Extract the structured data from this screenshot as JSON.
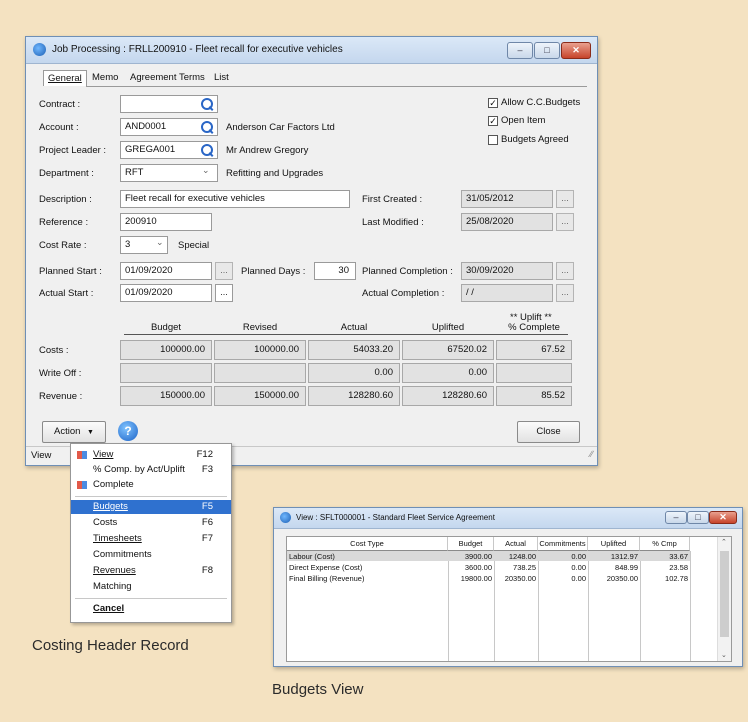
{
  "main": {
    "title": "Job Processing : FRLL200910 - Fleet recall for executive vehicles",
    "tabs": [
      {
        "label": "General"
      },
      {
        "label": "Memo"
      },
      {
        "label": "Agreement Terms"
      },
      {
        "label": "List"
      }
    ],
    "contract_label": "Contract :",
    "contract_value": "",
    "account_label": "Account :",
    "account_value": "AND0001",
    "account_name": "Anderson Car Factors Ltd",
    "project_leader_label": "Project Leader :",
    "project_leader_value": "GREGA001",
    "project_leader_name": "Mr Andrew Gregory",
    "department_label": "Department :",
    "department_value": "RFT",
    "department_name": "Refitting and Upgrades",
    "checks": [
      {
        "label": "Allow C.C.Budgets",
        "checked": true
      },
      {
        "label": "Open Item",
        "checked": true
      },
      {
        "label": "Budgets Agreed",
        "checked": false
      }
    ],
    "description_label": "Description :",
    "description_value": "Fleet recall for executive vehicles",
    "reference_label": "Reference :",
    "reference_value": "200910",
    "cost_rate_label": "Cost Rate :",
    "cost_rate_value": "3",
    "cost_rate_name": "Special",
    "first_created_label": "First Created :",
    "first_created_value": "31/05/2012",
    "last_modified_label": "Last Modified :",
    "last_modified_value": "25/08/2020",
    "planned_start_label": "Planned Start :",
    "planned_start_value": "01/09/2020",
    "planned_days_label": "Planned Days :",
    "planned_days_value": "30",
    "planned_completion_label": "Planned Completion :",
    "planned_completion_value": "30/09/2020",
    "actual_start_label": "Actual Start :",
    "actual_start_value": "01/09/2020",
    "actual_completion_label": "Actual Completion :",
    "actual_completion_value": "/ /",
    "uplift_note": "** Uplift **",
    "columns": [
      "Budget",
      "Revised",
      "Actual",
      "Uplifted",
      "% Complete"
    ],
    "rows": [
      {
        "label": "Costs :",
        "cells": [
          "100000.00",
          "100000.00",
          "54033.20",
          "67520.02",
          "67.52"
        ]
      },
      {
        "label": "Write Off :",
        "cells": [
          "",
          "",
          "0.00",
          "0.00",
          ""
        ]
      },
      {
        "label": "Revenue :",
        "cells": [
          "150000.00",
          "150000.00",
          "128280.60",
          "128280.60",
          "85.52"
        ]
      }
    ],
    "action_label": "Action",
    "close_label": "Close",
    "status_text": "View"
  },
  "menu": {
    "items": [
      {
        "label": "View",
        "key": "F12"
      },
      {
        "label": "% Comp. by Act/Uplift",
        "key": "F3"
      },
      {
        "label": "Complete",
        "key": ""
      },
      {
        "label": "Budgets",
        "key": "F5"
      },
      {
        "label": "Costs",
        "key": "F6"
      },
      {
        "label": "Timesheets",
        "key": "F7"
      },
      {
        "label": "Commitments",
        "key": ""
      },
      {
        "label": "Revenues",
        "key": "F8"
      },
      {
        "label": "Matching",
        "key": ""
      },
      {
        "label": "Cancel",
        "key": ""
      }
    ]
  },
  "budgets": {
    "title": "View : SFLT000001 - Standard Fleet Service Agreement",
    "columns": [
      "Cost Type",
      "Budget",
      "Actual",
      "Commitments",
      "Uplifted",
      "% Cmp"
    ],
    "rows": [
      [
        "Labour (Cost)",
        "3900.00",
        "1248.00",
        "0.00",
        "1312.97",
        "33.67"
      ],
      [
        "Direct Expense (Cost)",
        "3600.00",
        "738.25",
        "0.00",
        "848.99",
        "23.58"
      ],
      [
        "Final Billing (Revenue)",
        "19800.00",
        "20350.00",
        "0.00",
        "20350.00",
        "102.78"
      ]
    ]
  },
  "captions": {
    "costing": "Costing Header Record",
    "budgets": "Budgets View"
  },
  "colors": {
    "background": "#f4e2c1",
    "selection": "#2f71cf",
    "title_bar": "#c4d7ee"
  }
}
